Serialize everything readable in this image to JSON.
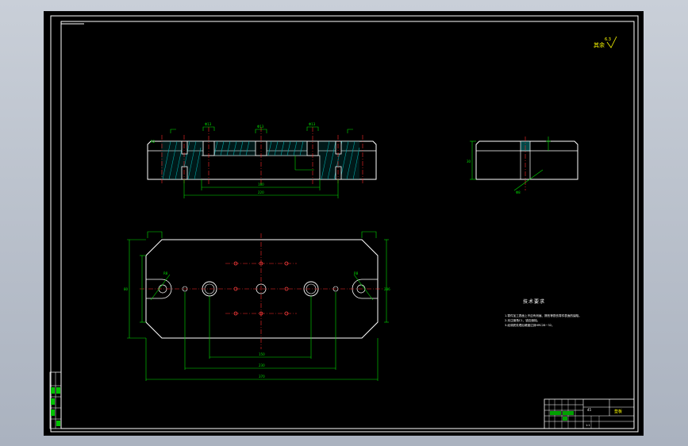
{
  "viewport": {
    "background": "#aab2bf",
    "canvas": "#000000"
  },
  "colors": {
    "outline": "#ffffff",
    "dimension": "#00e000",
    "centerline": "#ff2a2a",
    "hatch": "#00a8a8",
    "text_yellow": "#ffff00",
    "frame": "#ffffff"
  },
  "notes": {
    "title": "技术要求",
    "items": [
      "1.零件加工表面上不应有划痕、擦伤等损伤零件表面的缺陷。",
      "2.未注倒角C1，锐边倒钝。",
      "3.经调质处理后硬度达到HRC28~32。"
    ]
  },
  "roughness": {
    "label": "其余",
    "value": "6.3"
  },
  "title_block": {
    "part_name": "垫板",
    "material": "45",
    "scale": "1:1"
  },
  "views": {
    "front_section": {
      "top_dims": [
        "Φ13",
        "Φ13",
        "Φ13"
      ],
      "bottom_dims": [
        "180",
        "220"
      ],
      "left_dim": "R2"
    },
    "side_view": {
      "dims": [
        "30",
        "Φ8"
      ]
    },
    "plan_view": {
      "dims": [
        "370",
        "230",
        "150",
        "80",
        "286",
        "R8",
        "R8"
      ]
    }
  }
}
